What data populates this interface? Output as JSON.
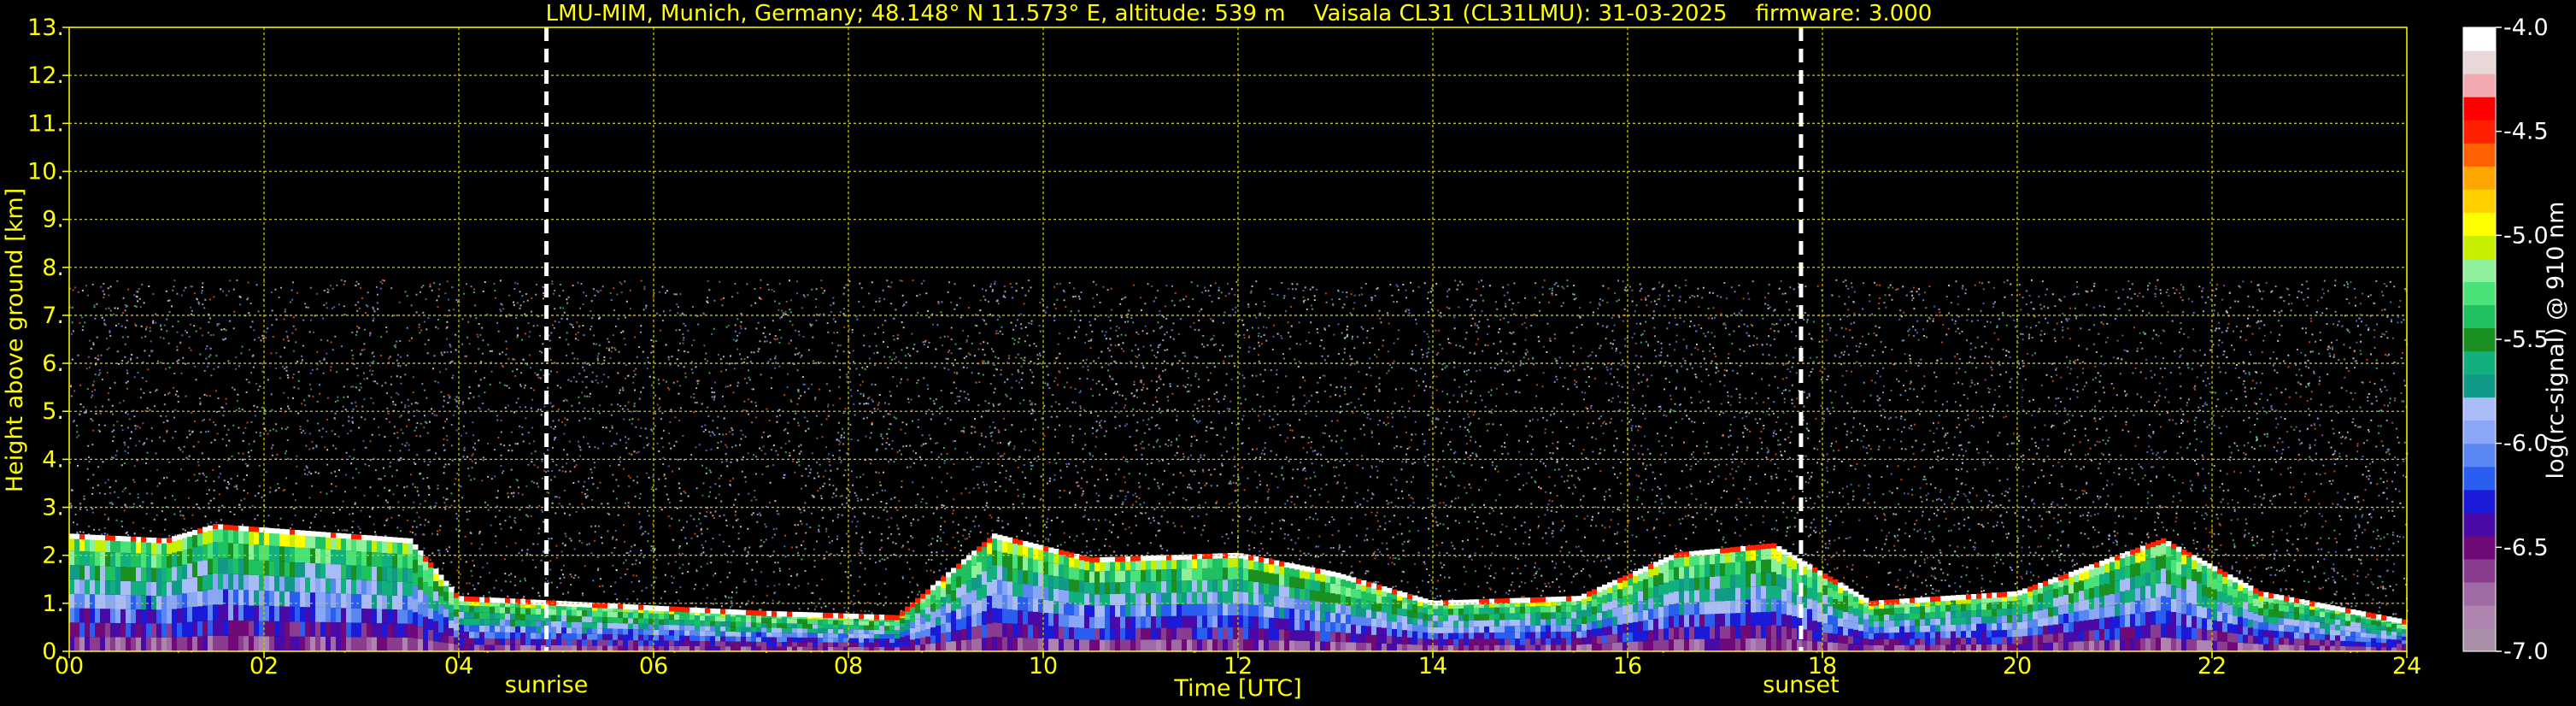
{
  "chart_data": {
    "type": "heatmap",
    "title": "LMU-MIM, Munich, Germany; 48.148° N 11.573° E, altitude: 539 m    Vaisala CL31 (CL31LMU): 31-03-2025    firmware: 3.000",
    "xlabel": "Time [UTC]",
    "ylabel": "Height above ground [km]",
    "xlim": [
      0,
      24
    ],
    "ylim": [
      0,
      13
    ],
    "x_ticks": [
      "00",
      "02",
      "04",
      "06",
      "08",
      "10",
      "12",
      "14",
      "16",
      "18",
      "20",
      "22",
      "24"
    ],
    "y_ticks": [
      "0.",
      "1.",
      "2.",
      "3.",
      "4.",
      "5.",
      "6.",
      "7.",
      "8.",
      "9.",
      "10.",
      "11.",
      "12.",
      "13."
    ],
    "grid": true,
    "markers": [
      {
        "label": "sunrise",
        "time_utc": 4.9
      },
      {
        "label": "sunset",
        "time_utc": 17.78
      }
    ],
    "signal_top_km": 7.75,
    "cloud_layer": [
      {
        "t": 0.0,
        "h": 2.4
      },
      {
        "t": 1.0,
        "h": 2.3
      },
      {
        "t": 1.5,
        "h": 2.6
      },
      {
        "t": 3.5,
        "h": 2.3
      },
      {
        "t": 4.0,
        "h": 1.1
      },
      {
        "t": 5.0,
        "h": 1.0
      },
      {
        "t": 7.0,
        "h": 0.8
      },
      {
        "t": 8.5,
        "h": 0.7
      },
      {
        "t": 9.5,
        "h": 2.4
      },
      {
        "t": 10.5,
        "h": 1.9
      },
      {
        "t": 12.0,
        "h": 2.0
      },
      {
        "t": 13.0,
        "h": 1.6
      },
      {
        "t": 14.0,
        "h": 1.0
      },
      {
        "t": 15.5,
        "h": 1.1
      },
      {
        "t": 16.5,
        "h": 2.0
      },
      {
        "t": 17.5,
        "h": 2.2
      },
      {
        "t": 18.5,
        "h": 1.0
      },
      {
        "t": 20.0,
        "h": 1.2
      },
      {
        "t": 21.5,
        "h": 2.3
      },
      {
        "t": 22.5,
        "h": 1.2
      },
      {
        "t": 24.0,
        "h": 0.6
      }
    ],
    "colorbar": {
      "label": "log(rc-signal) @ 910 nm",
      "min": -7.0,
      "max": -4.0,
      "ticks": [
        "-4.0",
        "-4.5",
        "-5.0",
        "-5.5",
        "-6.0",
        "-6.5",
        "-7.0"
      ],
      "colors_low_to_high": [
        "#a88ea6",
        "#ae83ae",
        "#a06aa4",
        "#8a3c8e",
        "#6f0a78",
        "#4a0aa8",
        "#1a1ad8",
        "#2a5ef0",
        "#5a86f2",
        "#8aa6f6",
        "#aabcf8",
        "#129a88",
        "#11b07e",
        "#1a9020",
        "#1fc060",
        "#48e278",
        "#8ef09a",
        "#c6f000",
        "#ffff00",
        "#ffd000",
        "#ffa500",
        "#ff6000",
        "#ff2000",
        "#ff0000",
        "#f4a8b0",
        "#e8d8d8",
        "#ffffff"
      ]
    }
  }
}
